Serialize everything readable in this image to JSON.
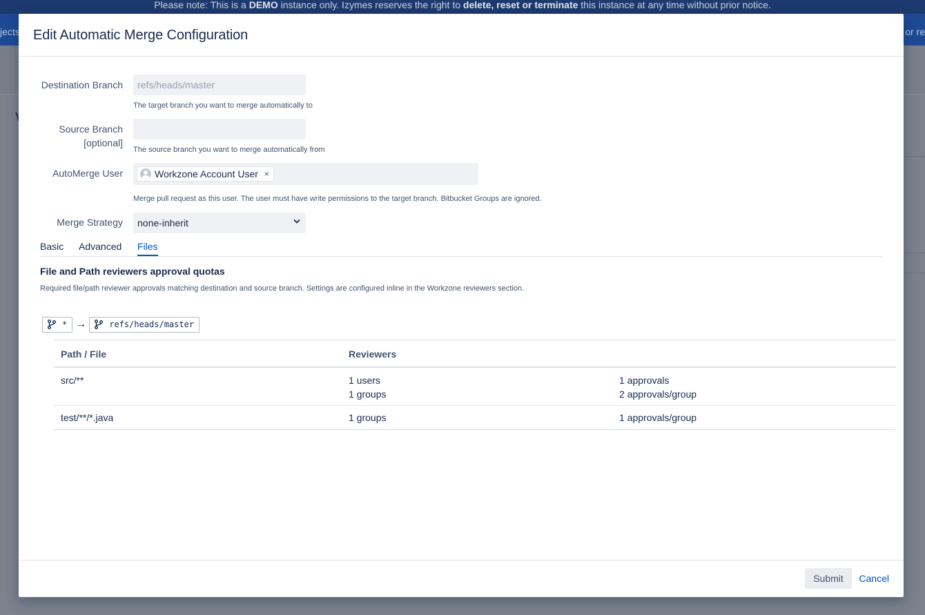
{
  "banner": {
    "prefix": "Please note: This is a ",
    "demo": "DEMO",
    "middle": " instance only. Izymes reserves the right to ",
    "actions": "delete, reset or terminate",
    "suffix": " this instance at any time without prior notice."
  },
  "nav": {
    "left_fragment": "jects",
    "right_fragment": "or re"
  },
  "background": {
    "heading_fragment": "V"
  },
  "dialog": {
    "title": "Edit Automatic Merge Configuration",
    "destination": {
      "label": "Destination Branch",
      "placeholder": "refs/heads/master",
      "help": "The target branch you want to merge automatically to"
    },
    "source": {
      "label_line1": "Source Branch",
      "label_line2": "[optional]",
      "value": "",
      "help": "The source branch you want to merge automatically from"
    },
    "automerge_user": {
      "label": "AutoMerge User",
      "chip": "Workzone Account User",
      "remove": "×",
      "help": "Merge pull request as this user. The user must have write permissions to the target branch. Bitbucket Groups are ignored."
    },
    "merge_strategy": {
      "label": "Merge Strategy",
      "selected": "none-inherit"
    },
    "tabs": [
      "Basic",
      "Advanced",
      "Files"
    ],
    "active_tab": "Files",
    "files": {
      "title": "File and Path reviewers approval quotas",
      "description": "Required file/path reviewer approvals matching destination and source branch. Settings are configured inline in the Workzone reviewers section.",
      "source_branch": "*",
      "arrow": "→",
      "target_branch": "refs/heads/master",
      "columns": {
        "path": "Path / File",
        "reviewers": "Reviewers"
      },
      "rows": [
        {
          "path": "src/**",
          "reviewers": [
            "1 users",
            "1 groups"
          ],
          "approvals": [
            "1 approvals",
            "2 approvals/group"
          ]
        },
        {
          "path": "test/**/*.java",
          "reviewers": [
            "1 groups"
          ],
          "approvals": [
            "1 approvals/group"
          ]
        }
      ]
    },
    "footer": {
      "submit": "Submit",
      "cancel": "Cancel"
    }
  },
  "icons": {
    "branch": "branch-icon",
    "avatar": "user-avatar-icon",
    "chevron": "chevron-down-icon"
  }
}
